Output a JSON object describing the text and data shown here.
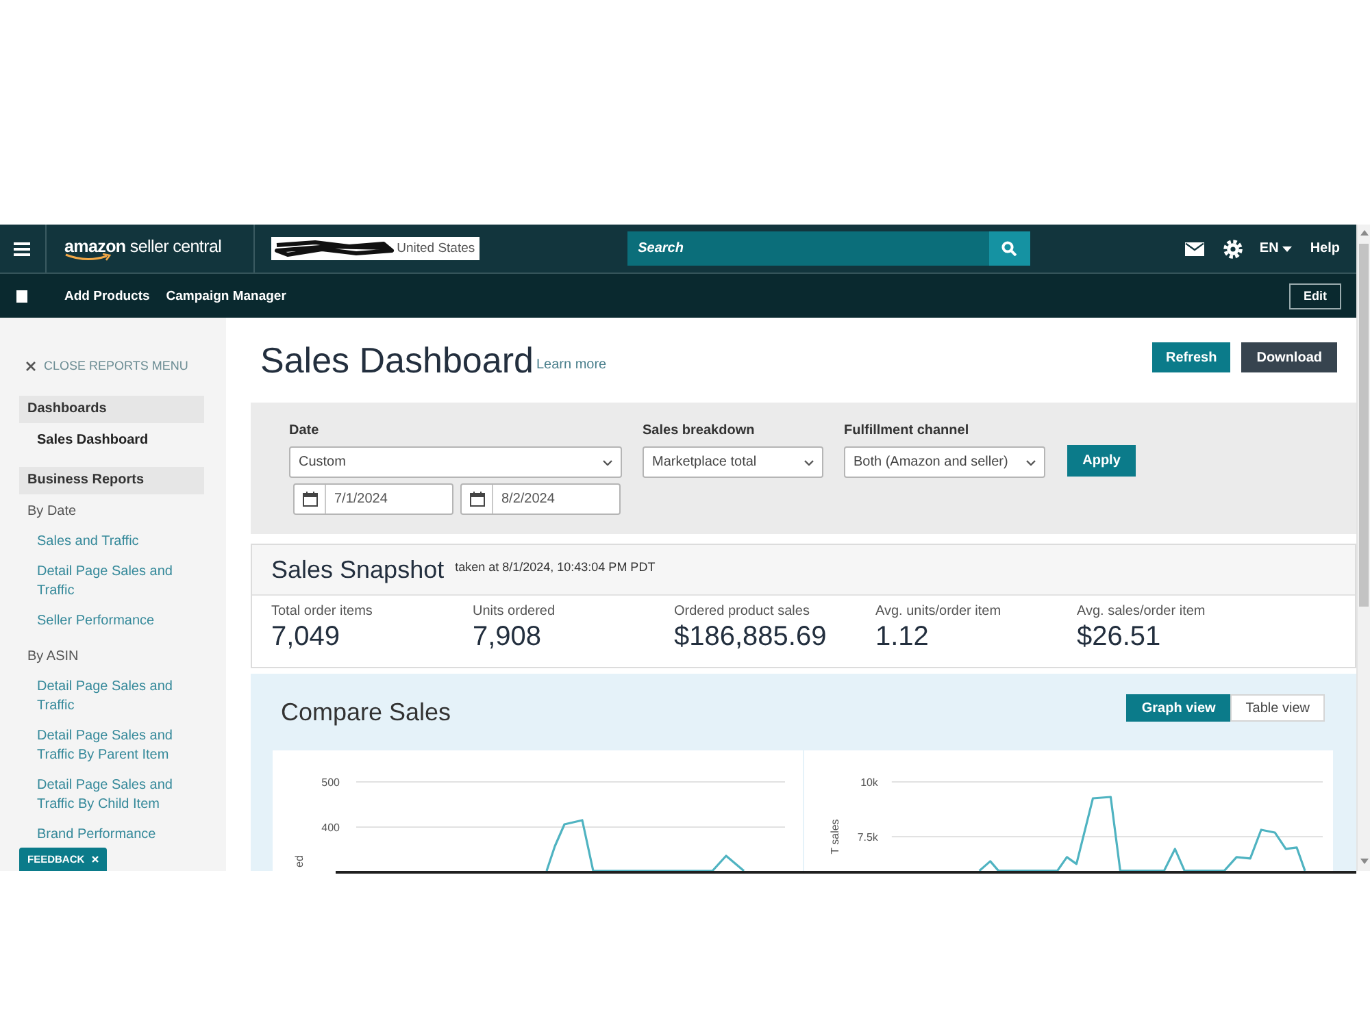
{
  "top_bar": {
    "logo": "**amazon** seller central",
    "store_selector": {
      "value": "United States",
      "redacted": true
    },
    "search": {
      "placeholder": "Search"
    },
    "language": "EN",
    "help": "Help"
  },
  "sub_nav": {
    "links": [
      "Add Products",
      "Campaign Manager"
    ],
    "edit": "Edit"
  },
  "sidebar": {
    "close_label": "CLOSE REPORTS MENU",
    "sections": [
      {
        "title": "Dashboards",
        "children": [
          {
            "label": "Sales Dashboard",
            "selected": true
          }
        ]
      },
      {
        "title": "Business Reports",
        "children": [
          {
            "label": "By Date",
            "children": [
              {
                "label": "Sales and Traffic",
                "selected": false
              },
              {
                "label": "Detail Page Sales and Traffic",
                "selected": false
              },
              {
                "label": "Seller Performance",
                "selected": false
              }
            ]
          },
          {
            "label": "By ASIN",
            "children": [
              {
                "label": "Detail Page Sales and Traffic",
                "selected": false
              },
              {
                "label": "Detail Page Sales and Traffic By Parent Item",
                "selected": false
              },
              {
                "label": "Detail Page Sales and Traffic By Child Item",
                "selected": false
              },
              {
                "label": "Brand Performance",
                "selected": false
              }
            ]
          }
        ]
      }
    ]
  },
  "feedback": {
    "label": "FEEDBACK"
  },
  "page": {
    "title": "Sales Dashboard",
    "learn_more": "Learn more",
    "actions": [
      {
        "label": "Refresh",
        "kind": "primary"
      },
      {
        "label": "Download",
        "kind": "dark"
      }
    ]
  },
  "filters": {
    "fields": [
      {
        "label": "Date",
        "value": "Custom",
        "range": [
          "7/1/2024",
          "8/2/2024"
        ]
      },
      {
        "label": "Sales breakdown",
        "value": "Marketplace total"
      },
      {
        "label": "Fulfillment channel",
        "value": "Both (Amazon and seller)"
      }
    ],
    "apply": "Apply"
  },
  "snapshot": {
    "title": "Sales Snapshot",
    "taken_at": "taken at 8/1/2024, 10:43:04 PM PDT",
    "metrics": [
      {
        "label": "Total order items",
        "value": "7,049"
      },
      {
        "label": "Units ordered",
        "value": "7,908"
      },
      {
        "label": "Ordered product sales",
        "value": "$186,885.69"
      },
      {
        "label": "Avg. units/order item",
        "value": "1.12"
      },
      {
        "label": "Avg. sales/order item",
        "value": "$26.51"
      }
    ]
  },
  "compare_sales": {
    "title": "Compare Sales",
    "views": [
      {
        "label": "Graph view",
        "selected": true
      },
      {
        "label": "Table view",
        "selected": false
      }
    ],
    "charts": [
      {
        "tick_labels": [
          "500",
          "400"
        ],
        "axis_label": "ed"
      },
      {
        "tick_labels": [
          "10k",
          "7.5k"
        ],
        "axis_label": "T sales"
      }
    ]
  }
}
